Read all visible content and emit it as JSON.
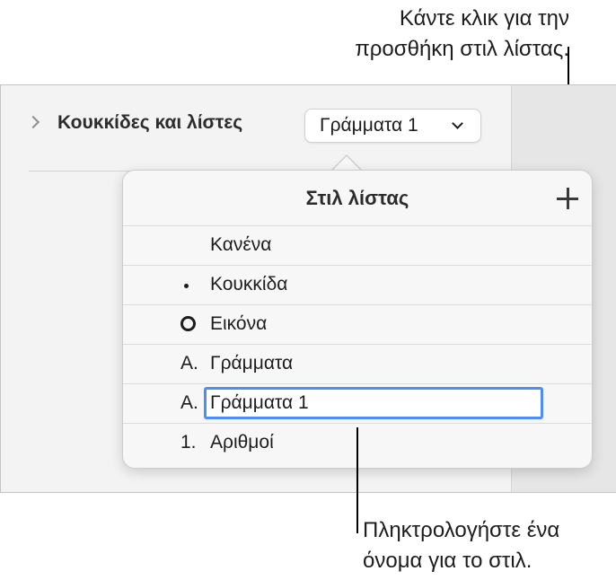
{
  "callouts": {
    "top_line1": "Κάντε κλικ για την",
    "top_line2": "προσθήκη στιλ λίστας.",
    "bottom_line1": "Πληκτρολογήστε ένα",
    "bottom_line2": "όνομα για το στιλ."
  },
  "sidebar": {
    "section_title": "Κουκκίδες και λίστες",
    "style_popup_value": "Γράμματα 1"
  },
  "popover": {
    "title": "Στιλ λίστας",
    "add_icon": "plus-icon",
    "items": [
      {
        "marker": "",
        "label": "Κανένα"
      },
      {
        "marker": "•",
        "label": "Κουκκίδα"
      },
      {
        "marker": "circle-image-icon",
        "label": "Εικόνα"
      },
      {
        "marker": "A.",
        "label": "Γράμματα"
      },
      {
        "marker": "A.",
        "label": "Γράμματα 1",
        "editing": true
      },
      {
        "marker": "1.",
        "label": "Αριθμοί"
      }
    ]
  },
  "colors": {
    "focus_ring": "#4f8cf5",
    "panel_bg": "#f3f3f3",
    "popover_bg": "#f7f7f7"
  }
}
